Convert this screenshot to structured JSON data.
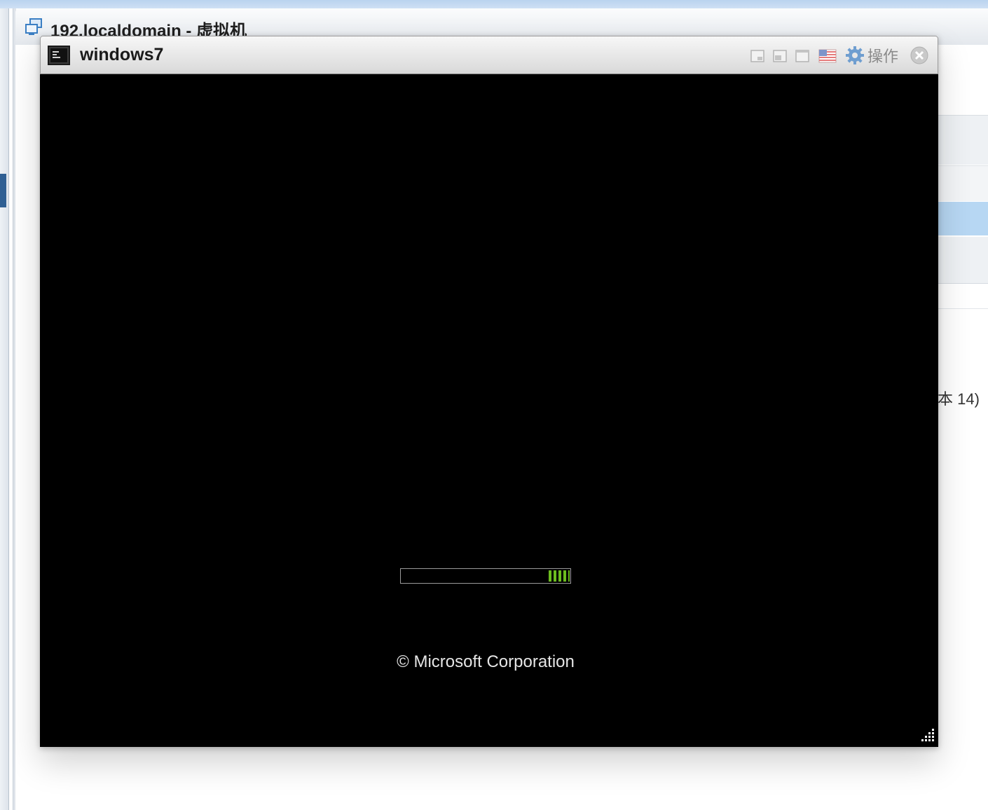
{
  "host_window": {
    "title": "192.localdomain - 虚拟机",
    "title_icon": "vm-group-icon",
    "background_fragment": "本 14)",
    "selected_row_color": "#b7d7f3"
  },
  "console_window": {
    "title": "windows7",
    "title_icon": "console-icon",
    "toolbar": {
      "minimize_icon": "window-minimize-icon",
      "restore_icon": "window-restore-icon",
      "maximize_icon": "window-maximize-icon",
      "keyboard_layout_icon": "us-flag-icon",
      "actions_icon": "gear-icon",
      "actions_label": "操作",
      "close_icon": "close-icon"
    },
    "screen": {
      "background_color": "#000000",
      "boot_progress_color": "#6cbc1f",
      "copyright_text": "© Microsoft Corporation",
      "resize_icon": "resize-grip-icon"
    }
  }
}
